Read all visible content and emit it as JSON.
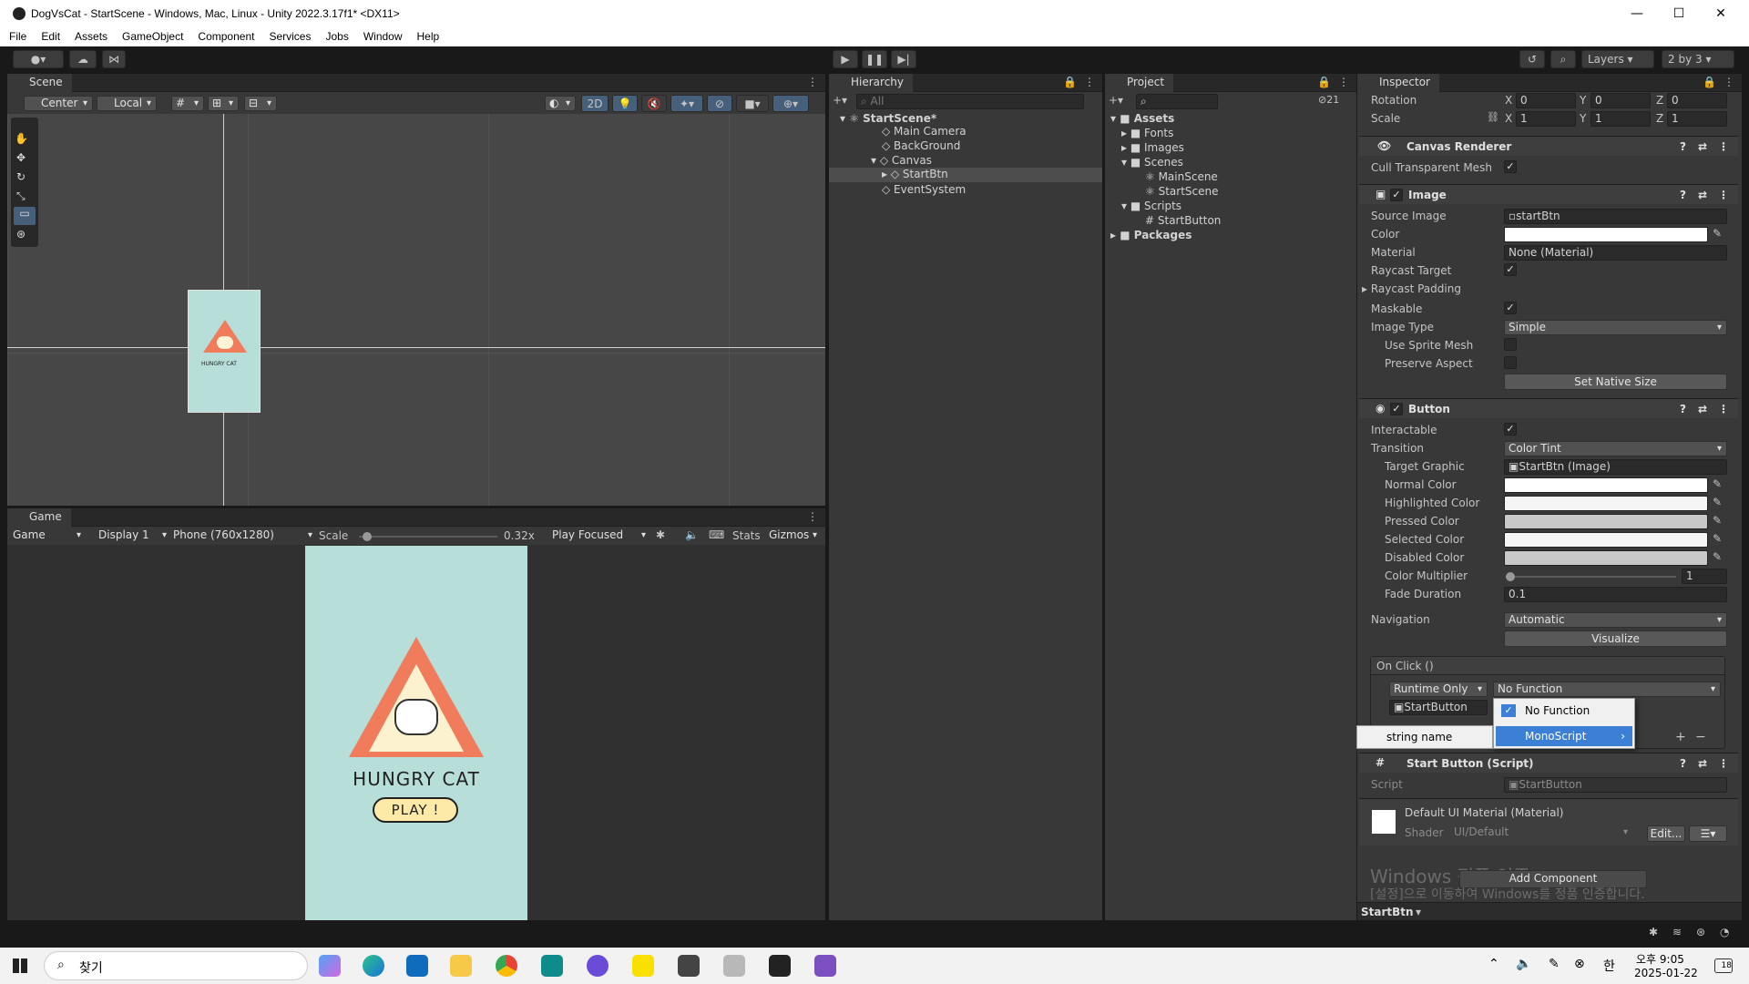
{
  "window": {
    "title": "DogVsCat - StartScene - Windows, Mac, Linux - Unity 2022.3.17f1* <DX11>",
    "minimize": "—",
    "maximize": "☐",
    "close": "✕"
  },
  "menu": [
    "File",
    "Edit",
    "Assets",
    "GameObject",
    "Component",
    "Services",
    "Jobs",
    "Window",
    "Help"
  ],
  "toolbar": {
    "layers": "Layers",
    "layout": "2 by 3"
  },
  "scene": {
    "tab": "Scene",
    "pivot": "Center",
    "space": "Local",
    "mode2d": "2D",
    "preview_title": "HUNGRY CAT"
  },
  "game": {
    "tab": "Game",
    "view": "Game",
    "display": "Display 1",
    "resolution": "Phone (760x1280)",
    "scale_label": "Scale",
    "scale_value": "0.32x",
    "scale_fraction": 0.03,
    "play_mode": "Play Focused",
    "stats": "Stats",
    "gizmos": "Gizmos",
    "title_text": "HUNGRY CAT",
    "play_button": "PLAY !",
    "bg_color": "#b7ded8",
    "accent_color": "#f07c5c"
  },
  "hierarchy": {
    "tab": "Hierarchy",
    "search_placeholder": "All",
    "scene_name": "StartScene*",
    "items": [
      {
        "label": "Main Camera",
        "depth": 1
      },
      {
        "label": "BackGround",
        "depth": 1
      },
      {
        "label": "Canvas",
        "depth": 1
      },
      {
        "label": "StartBtn",
        "depth": 2
      },
      {
        "label": "EventSystem",
        "depth": 1
      }
    ]
  },
  "project": {
    "tab": "Project",
    "count_badge": "21",
    "items": [
      {
        "label": "Assets",
        "depth": 0,
        "kind": "folder"
      },
      {
        "label": "Fonts",
        "depth": 1,
        "kind": "folder"
      },
      {
        "label": "Images",
        "depth": 1,
        "kind": "folder"
      },
      {
        "label": "Scenes",
        "depth": 1,
        "kind": "folder"
      },
      {
        "label": "MainScene",
        "depth": 2,
        "kind": "scene"
      },
      {
        "label": "StartScene",
        "depth": 2,
        "kind": "scene"
      },
      {
        "label": "Scripts",
        "depth": 1,
        "kind": "folder"
      },
      {
        "label": "StartButton",
        "depth": 2,
        "kind": "script"
      },
      {
        "label": "Packages",
        "depth": 0,
        "kind": "folder"
      }
    ]
  },
  "inspector": {
    "tab": "Inspector",
    "rotation": {
      "label": "Rotation",
      "x": "0",
      "y": "0",
      "z": "0"
    },
    "scale": {
      "label": "Scale",
      "x": "1",
      "y": "1",
      "z": "1"
    },
    "axis": {
      "x": "X",
      "y": "Y",
      "z": "Z"
    },
    "canvas_renderer": {
      "title": "Canvas Renderer",
      "cull_label": "Cull Transparent Mesh"
    },
    "image": {
      "title": "Image",
      "source_label": "Source Image",
      "source_value": "startBtn",
      "color_label": "Color",
      "material_label": "Material",
      "material_value": "None (Material)",
      "raycast_label": "Raycast Target",
      "raycast_padding_label": "Raycast Padding",
      "maskable_label": "Maskable",
      "image_type_label": "Image Type",
      "image_type_value": "Simple",
      "sprite_mesh_label": "Use Sprite Mesh",
      "preserve_label": "Preserve Aspect",
      "native_size_button": "Set Native Size"
    },
    "button": {
      "title": "Button",
      "interactable_label": "Interactable",
      "transition_label": "Transition",
      "transition_value": "Color Tint",
      "target_label": "Target Graphic",
      "target_value": "StartBtn (Image)",
      "normal_label": "Normal Color",
      "highlighted_label": "Highlighted Color",
      "pressed_label": "Pressed Color",
      "selected_label": "Selected Color",
      "disabled_label": "Disabled Color",
      "multiplier_label": "Color Multiplier",
      "multiplier_value": "1",
      "fade_label": "Fade Duration",
      "fade_value": "0.1",
      "navigation_label": "Navigation",
      "navigation_value": "Automatic",
      "visualize_button": "Visualize",
      "onclick_label": "On Click ()",
      "runtime_value": "Runtime Only",
      "function_value": "No Function",
      "object_value": "StartButton",
      "add": "+",
      "remove": "−"
    },
    "popup": {
      "no_function": "No Function",
      "monoscript": "MonoScript",
      "string_name": "string name"
    },
    "start_button_script": {
      "title": "Start Button (Script)",
      "script_label": "Script",
      "script_value": "StartButton"
    },
    "material": {
      "title": "Default UI Material (Material)",
      "shader_label": "Shader",
      "shader_value": "UI/Default",
      "edit_button": "Edit..."
    },
    "add_component": "Add Component",
    "watermark_line1": "Windows 정품 인증",
    "watermark_line2": "[설정]으로 이동하여 Windows를 정품 인증합니다.",
    "footer_object": "StartBtn"
  },
  "taskbar": {
    "search": "찾기",
    "time": "오후 9:05",
    "date": "2025-01-22",
    "ime": "한",
    "notif_count": "18"
  }
}
